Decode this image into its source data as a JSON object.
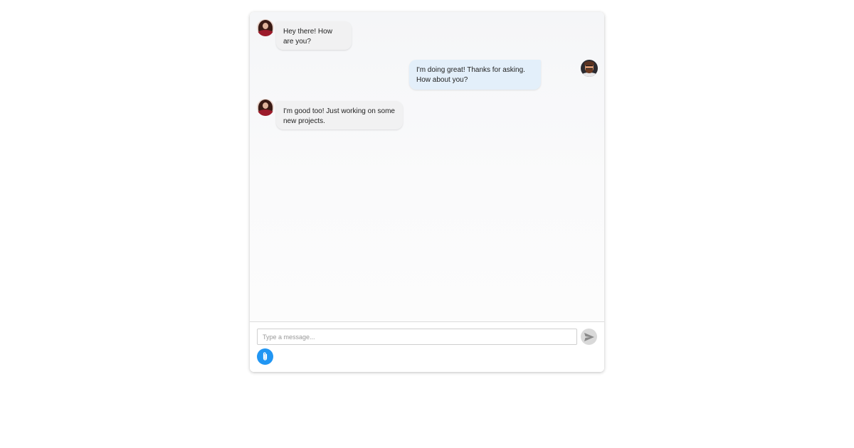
{
  "messages": [
    {
      "sender": "incoming",
      "avatar": "female-avatar",
      "text": "Hey there! How are you?"
    },
    {
      "sender": "outgoing",
      "avatar": "male-avatar",
      "text": "I'm doing great! Thanks for asking. How about you?"
    },
    {
      "sender": "incoming",
      "avatar": "female-avatar",
      "text": "I'm good too! Just working on some new projects."
    }
  ],
  "composer": {
    "placeholder": "Type a message...",
    "value": "",
    "send_icon": "send-icon",
    "attach_icon": "paperclip-icon"
  },
  "colors": {
    "incoming_bubble": "#f1f1f2",
    "outgoing_bubble": "#e3effa",
    "attach_button": "#2196f3",
    "send_button": "#d9d9d9"
  }
}
